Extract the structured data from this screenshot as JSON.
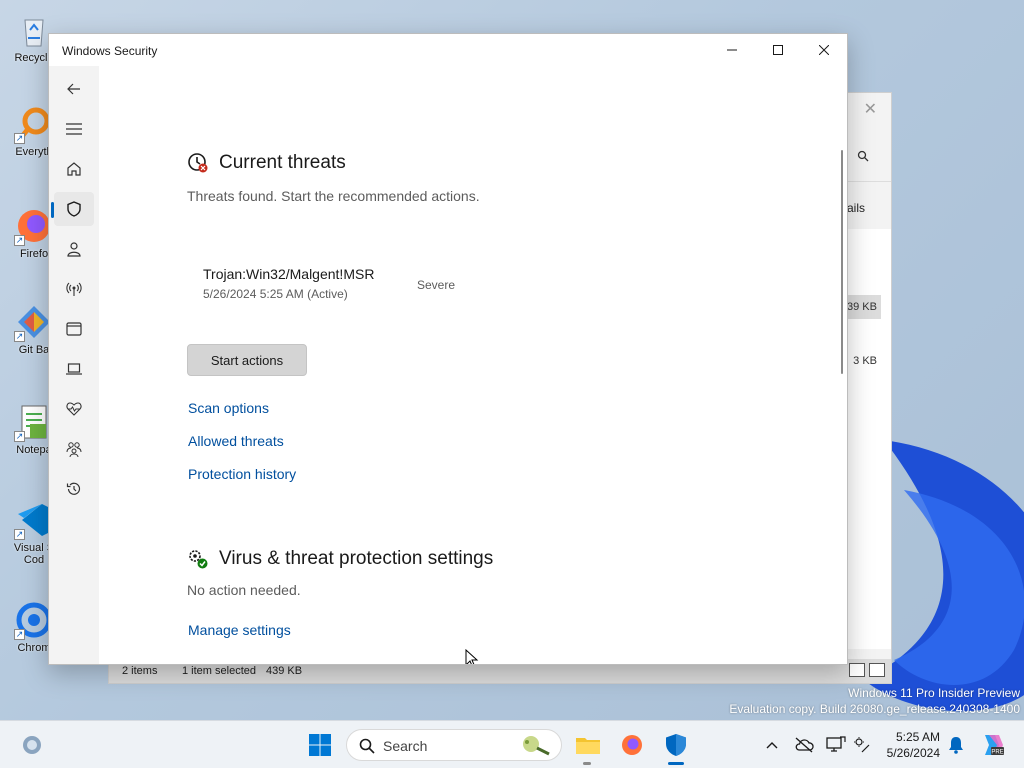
{
  "desktop": {
    "icons": [
      {
        "label": "Recycle",
        "icon": "recycle-bin-icon"
      },
      {
        "label": "Everyth",
        "icon": "everything-search-icon"
      },
      {
        "label": "Firefo",
        "icon": "firefox-icon"
      },
      {
        "label": "Git Ba",
        "icon": "git-bash-icon"
      },
      {
        "label": "Notepa",
        "icon": "notepad-icon"
      },
      {
        "label": "Visual S\nCod",
        "icon": "vscode-icon"
      },
      {
        "label": "Chrom",
        "icon": "chrome-icon"
      }
    ]
  },
  "background_window": {
    "details_label": "tails",
    "size_1": "39 KB",
    "size_2": "3 KB",
    "status": {
      "items": "2 items",
      "selected": "1 item selected",
      "size": "439 KB"
    }
  },
  "window": {
    "title": "Windows Security",
    "controls": {
      "minimize": "minimize-icon",
      "maximize": "maximize-icon",
      "close": "close-icon"
    }
  },
  "nav": {
    "items": [
      {
        "name": "back",
        "icon": "back-arrow-icon"
      },
      {
        "name": "menu",
        "icon": "hamburger-menu-icon"
      },
      {
        "name": "home",
        "icon": "home-icon"
      },
      {
        "name": "virus-protection",
        "icon": "shield-icon",
        "active": true
      },
      {
        "name": "account",
        "icon": "person-icon"
      },
      {
        "name": "firewall",
        "icon": "network-antenna-icon"
      },
      {
        "name": "app-browser",
        "icon": "browser-window-icon"
      },
      {
        "name": "device-security",
        "icon": "laptop-icon"
      },
      {
        "name": "device-health",
        "icon": "heart-pulse-icon"
      },
      {
        "name": "family",
        "icon": "family-icon"
      },
      {
        "name": "history",
        "icon": "history-icon"
      },
      {
        "name": "settings",
        "icon": "gear-icon"
      }
    ]
  },
  "current_threats": {
    "title": "Current threats",
    "description": "Threats found. Start the recommended actions.",
    "threat": {
      "name": "Trojan:Win32/Malgent!MSR",
      "date": "5/26/2024 5:25 AM (Active)",
      "severity": "Severe"
    },
    "start_button": "Start actions",
    "links": [
      "Scan options",
      "Allowed threats",
      "Protection history"
    ]
  },
  "settings_section": {
    "title": "Virus & threat protection settings",
    "description": "No action needed.",
    "link": "Manage settings"
  },
  "watermark": {
    "line1": "Windows 11 Pro Insider Preview",
    "line2": "Evaluation copy. Build 26080.ge_release.240308-1400"
  },
  "taskbar": {
    "search_label": "Search",
    "time": "5:25 AM",
    "date": "5/26/2024"
  },
  "colors": {
    "accent": "#0067c0",
    "link": "#004f9e",
    "threat_red": "#c42b1c",
    "ok_green": "#107c10"
  }
}
